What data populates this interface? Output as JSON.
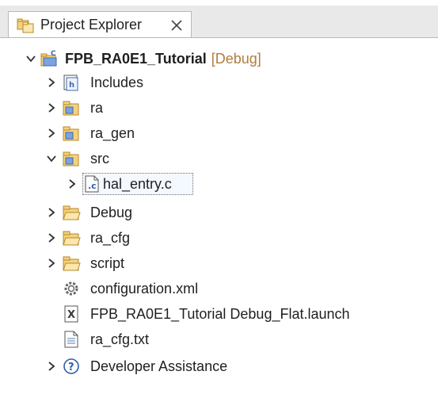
{
  "view": {
    "title": "Project Explorer"
  },
  "tree": {
    "project": {
      "name": "FPB_RA0E1_Tutorial",
      "decoration": "[Debug]"
    },
    "items": [
      {
        "label": "Includes"
      },
      {
        "label": "ra"
      },
      {
        "label": "ra_gen"
      },
      {
        "label": "src"
      },
      {
        "label": "hal_entry.c"
      },
      {
        "label": "Debug"
      },
      {
        "label": "ra_cfg"
      },
      {
        "label": "script"
      },
      {
        "label": "configuration.xml"
      },
      {
        "label": "FPB_RA0E1_Tutorial Debug_Flat.launch"
      },
      {
        "label": "ra_cfg.txt"
      },
      {
        "label": "Developer Assistance"
      }
    ]
  },
  "colors": {
    "folder_yellow": "#f5d27a",
    "source_folder_blue": "#4a78c2",
    "decoration_brown": "#b07d3b",
    "tab_bar_gray": "#e9e9e9"
  },
  "icons": {
    "tab": "project-explorer-icon",
    "project": "c-project-icon",
    "includes": "includes-icon",
    "source_folder": "source-folder-icon",
    "c_file": "c-file-icon",
    "folder": "folder-icon",
    "xml_config": "configuration-gear-icon",
    "launch": "launch-config-icon",
    "text_file": "text-file-icon",
    "help": "help-icon"
  }
}
